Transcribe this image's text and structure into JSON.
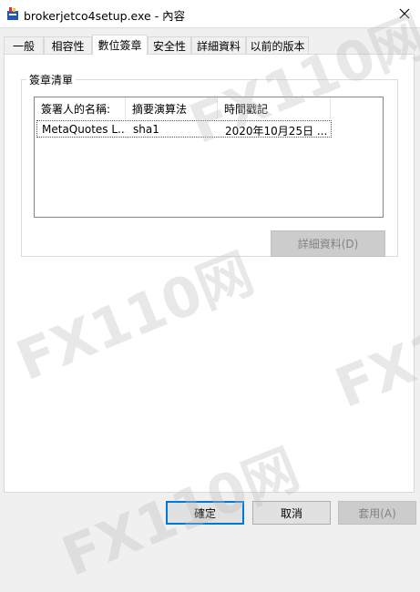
{
  "window": {
    "title": "brokerjetco4setup.exe - 內容"
  },
  "tabs": [
    {
      "label": "一般"
    },
    {
      "label": "相容性"
    },
    {
      "label": "數位簽章"
    },
    {
      "label": "安全性"
    },
    {
      "label": "詳細資料"
    },
    {
      "label": "以前的版本"
    }
  ],
  "signature_list": {
    "group_title": "簽章清單",
    "columns": [
      "簽署人的名稱:",
      "摘要演算法",
      "時間戳記"
    ],
    "rows": [
      {
        "signer": "MetaQuotes L...",
        "digest": "sha1",
        "timestamp": "2020年10月25日 ..."
      }
    ]
  },
  "buttons": {
    "details": "詳細資料(D)",
    "ok": "確定",
    "cancel": "取消",
    "apply": "套用(A)"
  },
  "watermark": {
    "text": "FX110网"
  }
}
